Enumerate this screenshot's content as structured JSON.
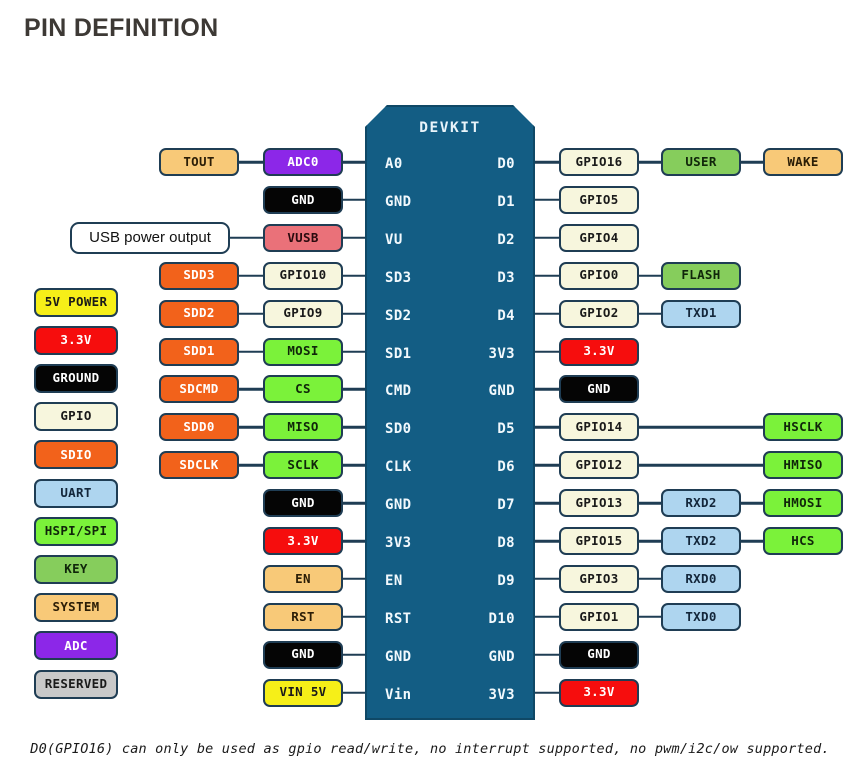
{
  "page": {
    "title": "PIN DEFINITION",
    "footnote": "D0(GPIO16) can only be used as gpio read/write, no interrupt supported, no pwm/i2c/ow supported."
  },
  "board": {
    "name": "DEVKIT",
    "body_color": "#135d84",
    "border_color": "#0f4866",
    "left_pins": [
      "A0",
      "GND",
      "VU",
      "SD3",
      "SD2",
      "SD1",
      "CMD",
      "SD0",
      "CLK",
      "GND",
      "3V3",
      "EN",
      "RST",
      "GND",
      "Vin"
    ],
    "right_pins": [
      "D0",
      "D1",
      "D2",
      "D3",
      "D4",
      "3V3",
      "GND",
      "D5",
      "D6",
      "D7",
      "D8",
      "D9",
      "D10",
      "GND",
      "3V3"
    ]
  },
  "callout": {
    "usb_power": "USB power output"
  },
  "legend": {
    "items": [
      {
        "label": "5V POWER",
        "color": "#f6ef18",
        "class": "c-pwr5"
      },
      {
        "label": "3.3V",
        "color": "#f60d0d",
        "class": "c-v33"
      },
      {
        "label": "GROUND",
        "color": "#050505",
        "class": "c-gnd"
      },
      {
        "label": "GPIO",
        "color": "#f7f6dd",
        "class": "c-gpio"
      },
      {
        "label": "SDIO",
        "color": "#f2621b",
        "class": "c-sdio"
      },
      {
        "label": "UART",
        "color": "#aed5ef",
        "class": "c-uart"
      },
      {
        "label": "HSPI/SPI",
        "color": "#7bf23a",
        "class": "c-hspi"
      },
      {
        "label": "KEY",
        "color": "#86cd5c",
        "class": "c-key"
      },
      {
        "label": "SYSTEM",
        "color": "#f8c978",
        "class": "c-system"
      },
      {
        "label": "ADC",
        "color": "#8c27e8",
        "class": "c-adc"
      },
      {
        "label": "RESERVED",
        "color": "#c9c9c9",
        "class": "c-reserved"
      }
    ]
  },
  "left_rows": [
    {
      "col2": "TOUT",
      "col2_class": "c-system",
      "col1": "ADC0",
      "col1_class": "c-adc"
    },
    {
      "col2": null,
      "col2_class": null,
      "col1": "GND",
      "col1_class": "c-gnd"
    },
    {
      "col2": null,
      "col2_class": null,
      "col1": "VUSB",
      "col1_class": "c-vusb"
    },
    {
      "col2": "SDD3",
      "col2_class": "c-sdio",
      "col1": "GPIO10",
      "col1_class": "c-gpio"
    },
    {
      "col2": "SDD2",
      "col2_class": "c-sdio",
      "col1": "GPIO9",
      "col1_class": "c-gpio"
    },
    {
      "col2": "SDD1",
      "col2_class": "c-sdio",
      "col1": "MOSI",
      "col1_class": "c-hspi"
    },
    {
      "col2": "SDCMD",
      "col2_class": "c-sdio",
      "col1": "CS",
      "col1_class": "c-hspi"
    },
    {
      "col2": "SDD0",
      "col2_class": "c-sdio",
      "col1": "MISO",
      "col1_class": "c-hspi"
    },
    {
      "col2": "SDCLK",
      "col2_class": "c-sdio",
      "col1": "SCLK",
      "col1_class": "c-hspi"
    },
    {
      "col2": null,
      "col2_class": null,
      "col1": "GND",
      "col1_class": "c-gnd"
    },
    {
      "col2": null,
      "col2_class": null,
      "col1": "3.3V",
      "col1_class": "c-v33"
    },
    {
      "col2": null,
      "col2_class": null,
      "col1": "EN",
      "col1_class": "c-system"
    },
    {
      "col2": null,
      "col2_class": null,
      "col1": "RST",
      "col1_class": "c-system"
    },
    {
      "col2": null,
      "col2_class": null,
      "col1": "GND",
      "col1_class": "c-gnd"
    },
    {
      "col2": null,
      "col2_class": null,
      "col1": "VIN 5V",
      "col1_class": "c-pwr5"
    }
  ],
  "right_rows": [
    {
      "col1": "GPIO16",
      "col1_class": "c-gpio",
      "col2": "USER",
      "col2_class": "c-key",
      "col3": "WAKE",
      "col3_class": "c-system"
    },
    {
      "col1": "GPIO5",
      "col1_class": "c-gpio",
      "col2": null,
      "col2_class": null,
      "col3": null,
      "col3_class": null
    },
    {
      "col1": "GPIO4",
      "col1_class": "c-gpio",
      "col2": null,
      "col2_class": null,
      "col3": null,
      "col3_class": null
    },
    {
      "col1": "GPIO0",
      "col1_class": "c-gpio",
      "col2": "FLASH",
      "col2_class": "c-key",
      "col3": null,
      "col3_class": null
    },
    {
      "col1": "GPIO2",
      "col1_class": "c-gpio",
      "col2": "TXD1",
      "col2_class": "c-uart",
      "col3": null,
      "col3_class": null
    },
    {
      "col1": "3.3V",
      "col1_class": "c-v33",
      "col2": null,
      "col2_class": null,
      "col3": null,
      "col3_class": null
    },
    {
      "col1": "GND",
      "col1_class": "c-gnd",
      "col2": null,
      "col2_class": null,
      "col3": null,
      "col3_class": null
    },
    {
      "col1": "GPIO14",
      "col1_class": "c-gpio",
      "col2": null,
      "col2_class": null,
      "col3": "HSCLK",
      "col3_class": "c-hspi"
    },
    {
      "col1": "GPIO12",
      "col1_class": "c-gpio",
      "col2": null,
      "col2_class": null,
      "col3": "HMISO",
      "col3_class": "c-hspi"
    },
    {
      "col1": "GPIO13",
      "col1_class": "c-gpio",
      "col2": "RXD2",
      "col2_class": "c-uart",
      "col3": "HMOSI",
      "col3_class": "c-hspi"
    },
    {
      "col1": "GPIO15",
      "col1_class": "c-gpio",
      "col2": "TXD2",
      "col2_class": "c-uart",
      "col3": "HCS",
      "col3_class": "c-hspi"
    },
    {
      "col1": "GPIO3",
      "col1_class": "c-gpio",
      "col2": "RXD0",
      "col2_class": "c-uart",
      "col3": null,
      "col3_class": null
    },
    {
      "col1": "GPIO1",
      "col1_class": "c-gpio",
      "col2": "TXD0",
      "col2_class": "c-uart",
      "col3": null,
      "col3_class": null
    },
    {
      "col1": "GND",
      "col1_class": "c-gnd",
      "col2": null,
      "col2_class": null,
      "col3": null,
      "col3_class": null
    },
    {
      "col1": "3.3V",
      "col1_class": "c-v33",
      "col2": null,
      "col2_class": null,
      "col3": null,
      "col3_class": null
    }
  ]
}
